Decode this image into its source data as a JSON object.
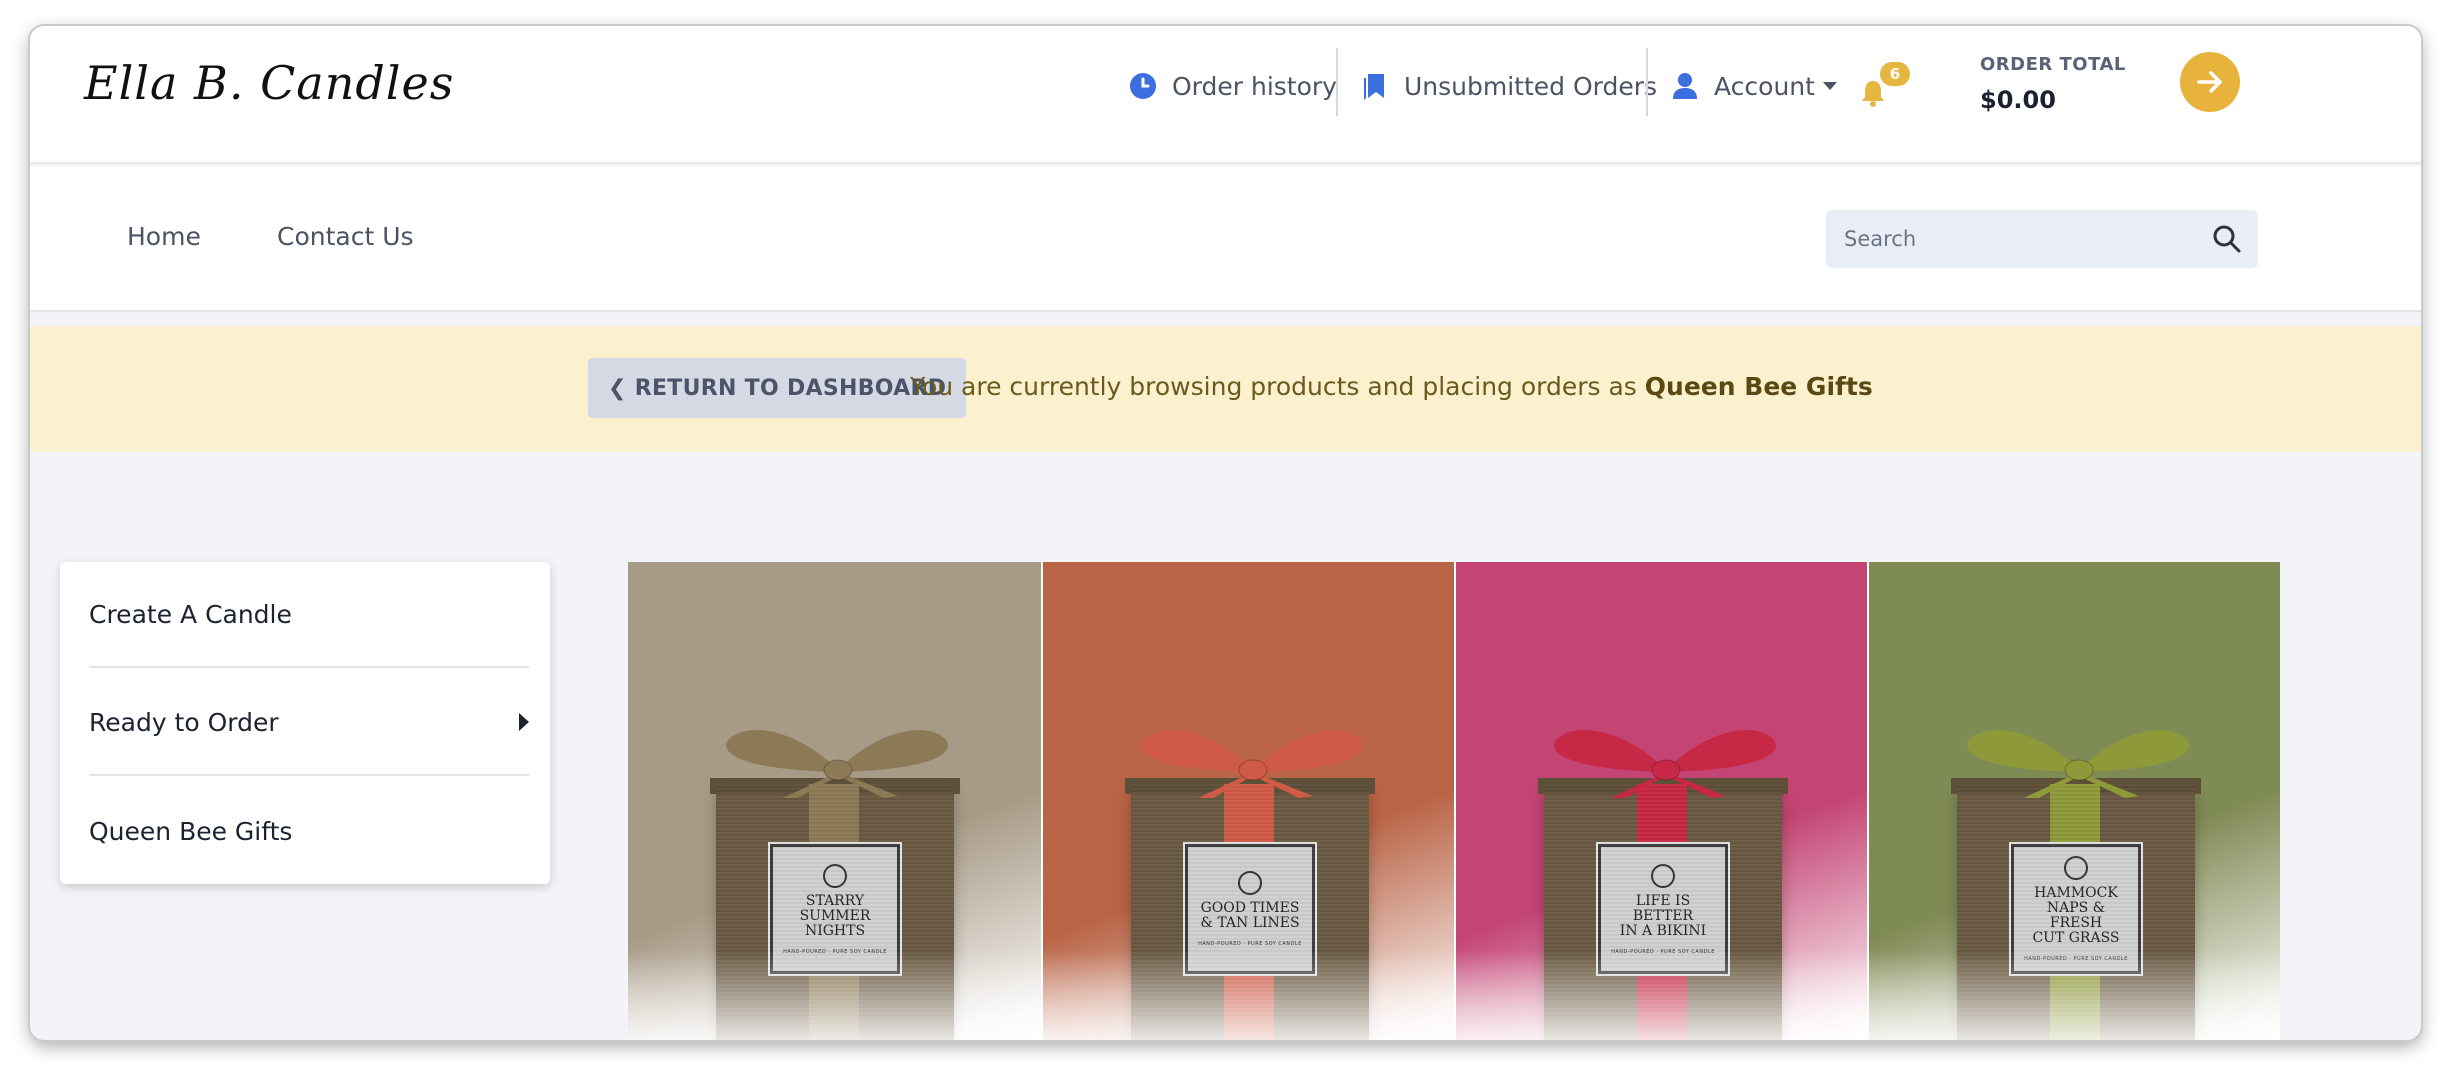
{
  "brand": {
    "logo_text": "Ella B. Candles"
  },
  "header": {
    "order_history": "Order history",
    "unsubmitted_orders": "Unsubmitted Orders",
    "account": "Account",
    "notifications_count": "6",
    "order_total_label": "ORDER TOTAL",
    "order_total_value": "$0.00"
  },
  "nav": {
    "home": "Home",
    "contact": "Contact Us",
    "search_placeholder": "Search"
  },
  "banner": {
    "return_label": "RETURN TO DASHBOARD",
    "message": "You are currently browsing products and placing orders as",
    "customer": "Queen Bee Gifts"
  },
  "sidebar": {
    "items": [
      {
        "label": "Create A Candle"
      },
      {
        "label": "Ready to Order"
      },
      {
        "label": "Queen Bee Gifts"
      }
    ]
  },
  "products": [
    {
      "name": "Starry Summer Nights",
      "label_line1": "STARRY",
      "label_line2": "SUMMER",
      "label_line3": "NIGHTS",
      "small_print": "HAND-POURED · PURE SOY CANDLE",
      "bg": "#a79a86",
      "ribbon": "#8c7a56"
    },
    {
      "name": "Good Times & Tan Lines",
      "label_line1": "GOOD TIMES",
      "label_line2": "& TAN LINES",
      "label_line3": "",
      "small_print": "HAND-POURED · PURE SOY CANDLE",
      "bg": "#b96446",
      "ribbon": "#cf5a45"
    },
    {
      "name": "Life is Better in a Bikini",
      "label_line1": "LIFE IS BETTER",
      "label_line2": "IN A BIKINI",
      "label_line3": "",
      "small_print": "HAND-POURED · PURE SOY CANDLE",
      "bg": "#c44574",
      "ribbon": "#c72845"
    },
    {
      "name": "Hammock Naps & Fresh Cut Grass",
      "label_line1": "HAMMOCK",
      "label_line2": "NAPS & FRESH",
      "label_line3": "CUT GRASS",
      "small_print": "HAND-POURED · PURE SOY CANDLE",
      "bg": "#7f8b55",
      "ribbon": "#8e9a3a"
    }
  ],
  "colors": {
    "accent": "#e8b33c",
    "banner_bg": "#fbf1cf",
    "link_icon_blue": "#3b6fe0"
  }
}
